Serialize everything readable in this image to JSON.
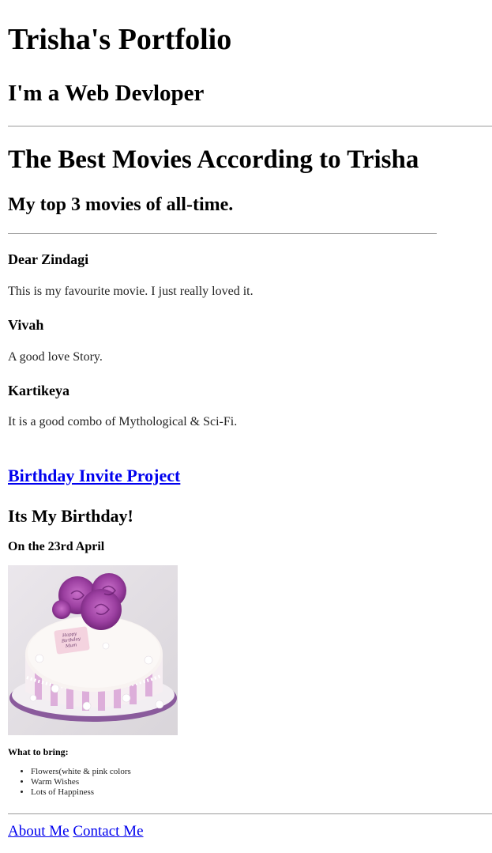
{
  "header": {
    "title": "Trisha's Portfolio",
    "subtitle": "I'm a Web Devloper"
  },
  "movies": {
    "title": "The Best Movies According to Trisha",
    "subtitle": "My top 3 movies of all-time.",
    "items": [
      {
        "name": "Dear Zindagi",
        "description": "This is my favourite movie. I just really loved it."
      },
      {
        "name": "Vivah",
        "description": "A good love Story."
      },
      {
        "name": "Kartikeya",
        "description": "It is a good combo of Mythological & Sci-Fi."
      }
    ]
  },
  "birthday": {
    "link_label": "Birthday Invite Project",
    "title": "Its My Birthday!",
    "date": "On the 23rd April",
    "cake_plaque_text": [
      "Happy",
      "Birthday",
      "Mum"
    ],
    "bring_title": "What to bring:",
    "bring_items": [
      "Flowers(white & pink colors",
      "Warm Wishes",
      "Lots of Happiness"
    ]
  },
  "footer": {
    "about_label": "About Me",
    "contact_label": "Contact Me"
  },
  "colors": {
    "link": "#0000ee",
    "divider": "#9a9a9a",
    "cake_purple": "#9b3fa0"
  }
}
